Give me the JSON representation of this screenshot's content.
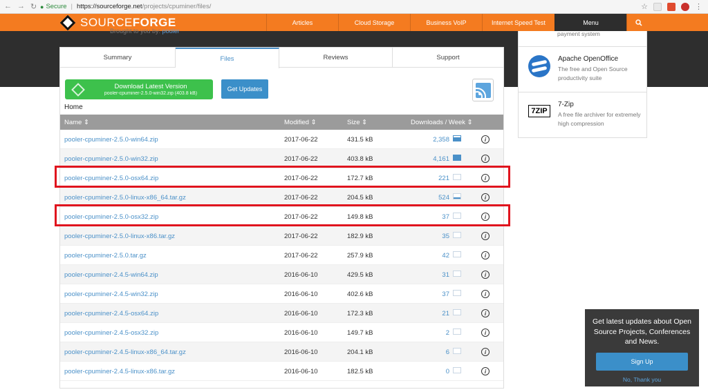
{
  "browser": {
    "secure_label": "Secure",
    "url_host": "https://sourceforge.net",
    "url_path": "/projects/cpuminer/files/"
  },
  "header": {
    "logo_word1": "SOURCE",
    "logo_word2": "FORGE",
    "brought_by_prefix": "Brought to you by:",
    "brought_by_user": "pooler",
    "nav": [
      "Articles",
      "Cloud Storage",
      "Business VoIP",
      "Internet Speed Test"
    ],
    "menu_label": "Menu",
    "accent_color": "#f47b20"
  },
  "sidebar": {
    "snippet": "payment system",
    "cards": [
      {
        "title": "Apache OpenOffice",
        "desc": "The free and Open Source productivity suite",
        "icon": "openoffice-icon"
      },
      {
        "title": "7-Zip",
        "desc": "A free file archiver for extremely high compression",
        "icon": "7zip-icon",
        "icon_text": "7ZIP"
      }
    ]
  },
  "tabs": [
    "Summary",
    "Files",
    "Reviews",
    "Support"
  ],
  "active_tab": "Files",
  "download": {
    "title": "Download Latest Version",
    "file": "pooler-cpuminer-2.5.0-win32.zip (403.8 kB)"
  },
  "get_updates_label": "Get Updates",
  "breadcrumb": "Home",
  "table": {
    "headers": {
      "name": "Name",
      "modified": "Modified",
      "size": "Size",
      "downloads": "Downloads / Week"
    },
    "rows": [
      {
        "name": "pooler-cpuminer-2.5.0-win64.zip",
        "modified": "2017-06-22",
        "size": "431.5 kB",
        "downloads": "2,358",
        "trend": "filled"
      },
      {
        "name": "pooler-cpuminer-2.5.0-win32.zip",
        "modified": "2017-06-22",
        "size": "403.8 kB",
        "downloads": "4,161",
        "trend": "filledfull"
      },
      {
        "name": "pooler-cpuminer-2.5.0-osx64.zip",
        "modified": "2017-06-22",
        "size": "172.7 kB",
        "downloads": "221",
        "trend": "empty"
      },
      {
        "name": "pooler-cpuminer-2.5.0-linux-x86_64.tar.gz",
        "modified": "2017-06-22",
        "size": "204.5 kB",
        "downloads": "524",
        "trend": "tiny"
      },
      {
        "name": "pooler-cpuminer-2.5.0-osx32.zip",
        "modified": "2017-06-22",
        "size": "149.8 kB",
        "downloads": "37",
        "trend": "empty"
      },
      {
        "name": "pooler-cpuminer-2.5.0-linux-x86.tar.gz",
        "modified": "2017-06-22",
        "size": "182.9 kB",
        "downloads": "35",
        "trend": "empty"
      },
      {
        "name": "pooler-cpuminer-2.5.0.tar.gz",
        "modified": "2017-06-22",
        "size": "257.9 kB",
        "downloads": "42",
        "trend": "empty"
      },
      {
        "name": "pooler-cpuminer-2.4.5-win64.zip",
        "modified": "2016-06-10",
        "size": "429.5 kB",
        "downloads": "31",
        "trend": "empty"
      },
      {
        "name": "pooler-cpuminer-2.4.5-win32.zip",
        "modified": "2016-06-10",
        "size": "402.6 kB",
        "downloads": "37",
        "trend": "empty"
      },
      {
        "name": "pooler-cpuminer-2.4.5-osx64.zip",
        "modified": "2016-06-10",
        "size": "172.3 kB",
        "downloads": "21",
        "trend": "empty"
      },
      {
        "name": "pooler-cpuminer-2.4.5-osx32.zip",
        "modified": "2016-06-10",
        "size": "149.7 kB",
        "downloads": "2",
        "trend": "empty"
      },
      {
        "name": "pooler-cpuminer-2.4.5-linux-x86_64.tar.gz",
        "modified": "2016-06-10",
        "size": "204.1 kB",
        "downloads": "6",
        "trend": "empty"
      },
      {
        "name": "pooler-cpuminer-2.4.5-linux-x86.tar.gz",
        "modified": "2016-06-10",
        "size": "182.5 kB",
        "downloads": "0",
        "trend": "empty"
      }
    ]
  },
  "highlight_color": "#e0141e",
  "newsletter": {
    "message": "Get latest updates about Open Source Projects, Conferences and News.",
    "signup_label": "Sign Up",
    "decline_label": "No, Thank you"
  }
}
